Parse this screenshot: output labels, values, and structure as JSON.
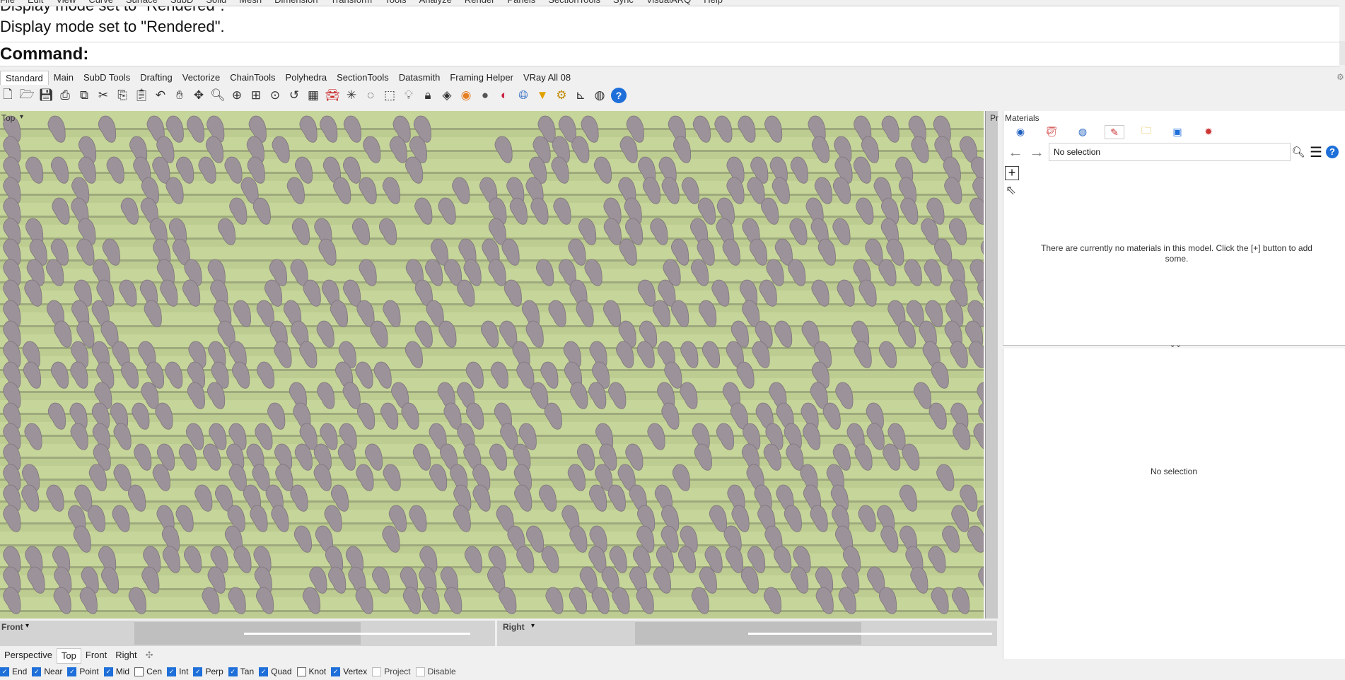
{
  "menubar": {
    "items": [
      "File",
      "Edit",
      "View",
      "Curve",
      "Surface",
      "SubD",
      "Solid",
      "Mesh",
      "Dimension",
      "Transform",
      "Tools",
      "Analyze",
      "Render",
      "Panels",
      "SectionTools",
      "Sync",
      "VisualARQ",
      "Help"
    ]
  },
  "command": {
    "history": [
      "Display mode set to \"Rendered\".",
      "Display mode set to \"Rendered\"."
    ],
    "prompt": "Command:"
  },
  "toolbar_tabs": [
    "Standard",
    "Main",
    "SubD Tools",
    "Drafting",
    "Vectorize",
    "ChainTools",
    "Polyhedra",
    "SectionTools",
    "Datasmith",
    "Framing Helper",
    "VRay All 08"
  ],
  "active_tab": "Standard",
  "toolbar_icons": [
    "new-icon",
    "open-icon",
    "save-icon",
    "print-icon",
    "import-icon",
    "cut-icon",
    "copy-icon",
    "paste-icon",
    "undo-icon",
    "pan-icon",
    "rotate-icon",
    "zoom-icon",
    "zoom-window-icon",
    "zoom-extents-icon",
    "zoom-selected-icon",
    "undo-view-icon",
    "grid-icon",
    "car-icon",
    "snap-icon",
    "circle-icon",
    "shapes-icon",
    "light-icon",
    "lock-icon",
    "layer-icon",
    "color-wheel-icon",
    "sphere-icon",
    "material-icon",
    "globe-icon",
    "filter-icon",
    "gear-icon",
    "dims-icon",
    "render-icon",
    "help-icon"
  ],
  "viewport": {
    "title": "Top",
    "side_label": "Pr",
    "colors": {
      "ground": "#c6d59a",
      "stripe": "#7d8766",
      "shape": "#9c9299"
    }
  },
  "mini_viewports": {
    "front": "Front",
    "right": "Right"
  },
  "viewport_tabs": [
    "Perspective",
    "Top",
    "Front",
    "Right"
  ],
  "viewport_tabs_active": "Top",
  "osnaps": [
    {
      "label": "End",
      "checked": true
    },
    {
      "label": "Near",
      "checked": true
    },
    {
      "label": "Point",
      "checked": true
    },
    {
      "label": "Mid",
      "checked": true
    },
    {
      "label": "Cen",
      "checked": false
    },
    {
      "label": "Int",
      "checked": true
    },
    {
      "label": "Perp",
      "checked": true
    },
    {
      "label": "Tan",
      "checked": true
    },
    {
      "label": "Quad",
      "checked": true
    },
    {
      "label": "Knot",
      "checked": false
    },
    {
      "label": "Vertex",
      "checked": true
    },
    {
      "label": "Project",
      "checked": false
    },
    {
      "label": "Disable",
      "checked": false
    }
  ],
  "panel": {
    "title": "Materials",
    "icons": [
      "render-sphere-icon",
      "paint-bucket-icon",
      "environment-icon",
      "materials-brush-icon",
      "folder-icon",
      "image-icon",
      "sun-icon"
    ],
    "selection": "No selection",
    "add_symbol": "+",
    "help_symbol": "?",
    "empty_message": "There are currently no materials in this model. Click the [+] button to add some.",
    "bottom_text": "No selection"
  }
}
